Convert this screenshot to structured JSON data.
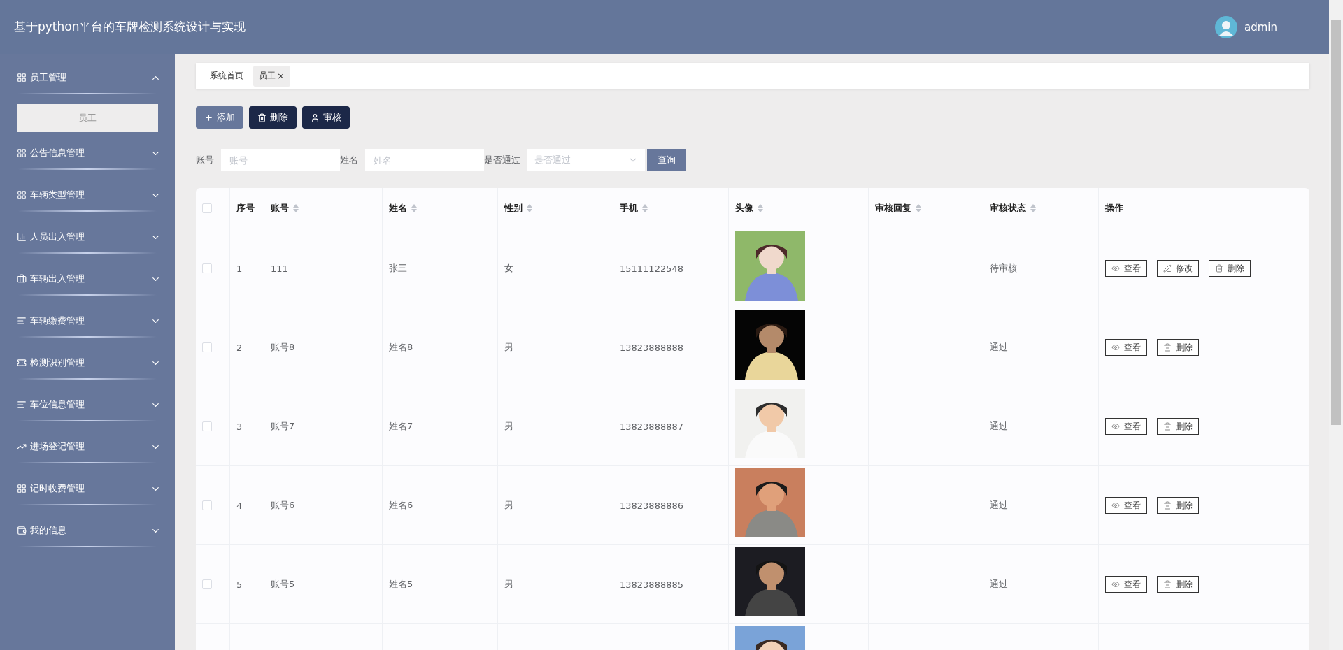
{
  "header": {
    "title": "基于python平台的车牌检测系统设计与实现",
    "user": "admin"
  },
  "sidebar": {
    "items": [
      {
        "label": "员工管理",
        "expanded": true,
        "children": [
          {
            "label": "员工",
            "selected": true
          }
        ]
      },
      {
        "label": "公告信息管理",
        "expanded": false
      },
      {
        "label": "车辆类型管理",
        "expanded": false
      },
      {
        "label": "人员出入管理",
        "expanded": false
      },
      {
        "label": "车辆出入管理",
        "expanded": false
      },
      {
        "label": "车辆缴费管理",
        "expanded": false
      },
      {
        "label": "检测识别管理",
        "expanded": false
      },
      {
        "label": "车位信息管理",
        "expanded": false
      },
      {
        "label": "进场登记管理",
        "expanded": false
      },
      {
        "label": "记时收费管理",
        "expanded": false
      },
      {
        "label": "我的信息",
        "expanded": false
      }
    ]
  },
  "tabs": [
    {
      "label": "系统首页",
      "selected": false
    },
    {
      "label": "员工",
      "selected": true,
      "close": "×"
    }
  ],
  "toolbar": [
    {
      "label": "添加",
      "kind": "add"
    },
    {
      "label": "删除",
      "kind": "delete"
    },
    {
      "label": "审核",
      "kind": "review"
    }
  ],
  "search": {
    "fields": [
      {
        "label": "账号",
        "placeholder": "账号",
        "kind": "input"
      },
      {
        "label": "姓名",
        "placeholder": "姓名",
        "kind": "input"
      },
      {
        "label": "是否通过",
        "placeholder": "是否通过",
        "kind": "select"
      }
    ],
    "button": "查询"
  },
  "table": {
    "select_all": {
      "checked": false
    },
    "columns": [
      {
        "label": "序号",
        "sortable": false
      },
      {
        "label": "账号",
        "sortable": true
      },
      {
        "label": "姓名",
        "sortable": true
      },
      {
        "label": "性别",
        "sortable": true
      },
      {
        "label": "手机",
        "sortable": true
      },
      {
        "label": "头像",
        "sortable": true
      },
      {
        "label": "审核回复",
        "sortable": true
      },
      {
        "label": "审核状态",
        "sortable": true
      },
      {
        "label": "操作",
        "sortable": false
      }
    ],
    "rows": [
      {
        "checked": false,
        "index": "1",
        "account": "111",
        "name": "张三",
        "gender": "女",
        "phone": "15111122548",
        "avatar": {
          "kind": "picture"
        },
        "status": "待审核",
        "actions": [
          {
            "label": "查看",
            "kind": "view"
          },
          {
            "label": "修改",
            "kind": "edit"
          },
          {
            "label": "删除",
            "kind": "delete"
          }
        ]
      },
      {
        "checked": false,
        "index": "2",
        "account": "账号8",
        "name": "姓名8",
        "gender": "男",
        "phone": "13823888888",
        "avatar": {
          "kind": "picture"
        },
        "status": "通过",
        "actions": [
          {
            "label": "查看",
            "kind": "view"
          },
          {
            "label": "删除",
            "kind": "delete"
          }
        ]
      },
      {
        "checked": false,
        "index": "3",
        "account": "账号7",
        "name": "姓名7",
        "gender": "男",
        "phone": "13823888887",
        "avatar": {
          "kind": "picture"
        },
        "status": "通过",
        "actions": [
          {
            "label": "查看",
            "kind": "view"
          },
          {
            "label": "删除",
            "kind": "delete"
          }
        ]
      },
      {
        "checked": false,
        "index": "4",
        "account": "账号6",
        "name": "姓名6",
        "gender": "男",
        "phone": "13823888886",
        "avatar": {
          "kind": "picture"
        },
        "status": "通过",
        "actions": [
          {
            "label": "查看",
            "kind": "view"
          },
          {
            "label": "删除",
            "kind": "delete"
          }
        ]
      },
      {
        "checked": false,
        "index": "5",
        "account": "账号5",
        "name": "姓名5",
        "gender": "男",
        "phone": "13823888885",
        "avatar": {
          "kind": "picture"
        },
        "status": "通过",
        "actions": [
          {
            "label": "查看",
            "kind": "view"
          },
          {
            "label": "删除",
            "kind": "delete"
          }
        ]
      },
      {
        "avatar": {
          "kind": "picture"
        }
      }
    ]
  }
}
